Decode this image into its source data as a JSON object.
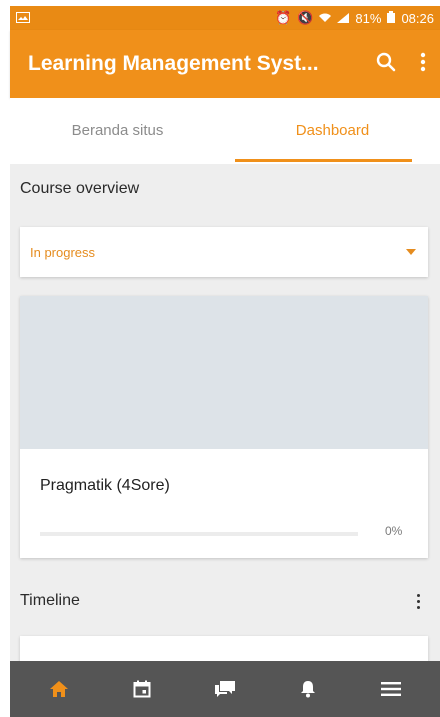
{
  "status_bar": {
    "signal_text": "81%",
    "time": "08:26"
  },
  "app_bar": {
    "title": "Learning Management Syst...",
    "search_icon": "search-icon",
    "more_icon": "more-vertical-icon"
  },
  "tabs": [
    {
      "label": "Beranda situs",
      "active": false
    },
    {
      "label": "Dashboard",
      "active": true
    }
  ],
  "course_overview": {
    "title": "Course overview",
    "filter": "In progress",
    "course": {
      "name": "Pragmatik (4Sore)",
      "progress": 0,
      "progress_label": "0%"
    }
  },
  "timeline": {
    "title": "Timeline"
  },
  "bottom_nav": {
    "items": [
      "home-icon",
      "calendar-icon",
      "messages-icon",
      "notifications-icon",
      "menu-icon"
    ],
    "active": "home-icon"
  },
  "colors": {
    "accent": "#f0901a",
    "bottom_nav_bg": "#555555",
    "content_bg": "#eeeeee"
  }
}
